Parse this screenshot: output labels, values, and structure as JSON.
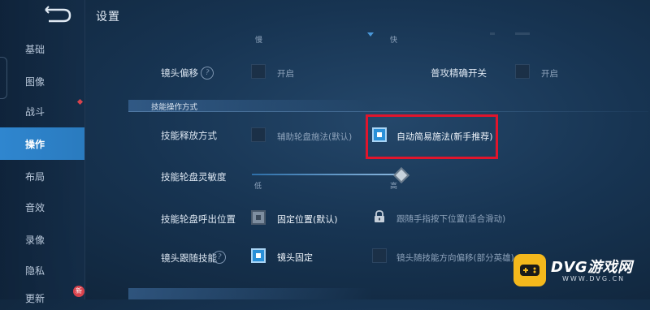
{
  "header": {
    "title": "设置"
  },
  "sidebar": {
    "items": [
      {
        "label": "基础"
      },
      {
        "label": "图像"
      },
      {
        "label": "战斗"
      },
      {
        "label": "操作"
      },
      {
        "label": "布局"
      },
      {
        "label": "音效"
      },
      {
        "label": "录像"
      },
      {
        "label": "隐私"
      },
      {
        "label": "更新"
      }
    ],
    "active_item": "操作",
    "new_badge": "新"
  },
  "top_slider": {
    "min_label": "慢",
    "max_label": "快"
  },
  "camera_offset": {
    "label": "镜头偏移",
    "help": "?",
    "option_label": "开启",
    "checked": false
  },
  "normal_attack_precise": {
    "label": "普攻精确开关",
    "option_label": "开启",
    "checked": false
  },
  "section": {
    "title": "技能操作方式"
  },
  "skill_release": {
    "label": "技能释放方式",
    "options": [
      {
        "label": "辅助轮盘施法(默认)",
        "checked": false
      },
      {
        "label": "自动简易施法(新手推荐)",
        "checked": true
      }
    ]
  },
  "wheel_sensitivity": {
    "label": "技能轮盘灵敏度",
    "min_label": "低",
    "max_label": "高",
    "value_fraction": 1.0
  },
  "wheel_position": {
    "label": "技能轮盘呼出位置",
    "options": [
      {
        "label": "固定位置(默认)",
        "checked": true,
        "locked": false
      },
      {
        "label": "跟随手指按下位置(适合滑动)",
        "checked": false,
        "locked": true
      }
    ]
  },
  "camera_follow": {
    "label": "镜头跟随技能",
    "help": "?",
    "options": [
      {
        "label": "镜头固定",
        "checked": true
      },
      {
        "label": "镜头随技能方向偏移(部分英雄)",
        "checked": false
      }
    ]
  },
  "watermark": {
    "logo_text": "DVG游戏网",
    "sub_text": "WWW.DVG.CN"
  },
  "colors": {
    "accent": "#2a90d8",
    "highlight": "#e0152c",
    "active_tab": "#2f86cf"
  }
}
